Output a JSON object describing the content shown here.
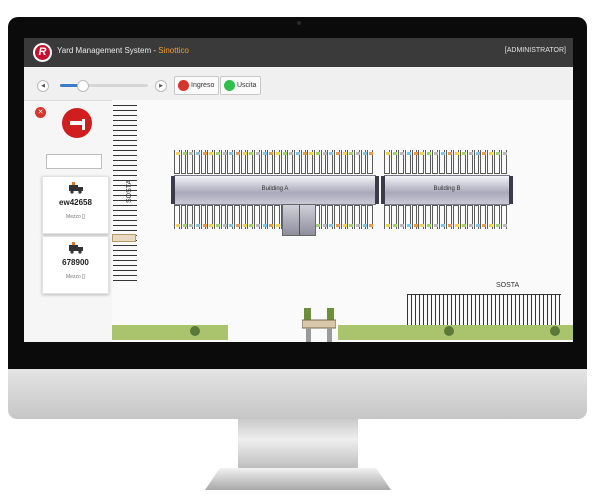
{
  "app": {
    "title": "Yard Management System",
    "separator": " - ",
    "section": "Sinottico",
    "user": "[ADMINISTRATOR]"
  },
  "toolbar": {
    "prev_icon": "chevron-left-icon",
    "next_icon": "chevron-right-icon",
    "zoom_level": 0.25,
    "ingresso_label": "Ingreso",
    "uscita_label": "Uscita",
    "ingresso_color": "#d8342b",
    "uscita_color": "#2fbf4a"
  },
  "sidebar": {
    "close_icon": "close-icon",
    "gate_icon": "barrier-gate-icon",
    "search_value": "",
    "cards": [
      {
        "code": "ew42658",
        "sub": "Mezzo []",
        "icon": "truck-icon"
      },
      {
        "code": "678900",
        "sub": "Mezzo []",
        "icon": "truck-icon"
      }
    ]
  },
  "map": {
    "sosta_left": "SOSTA",
    "sosta_bottom": "SOSTA",
    "buildings": [
      {
        "name": "Building A"
      },
      {
        "name": "Building B"
      }
    ],
    "colors": {
      "accent": "#f0a030",
      "brand": "#c8102e",
      "grass": "#a9c46d"
    }
  }
}
